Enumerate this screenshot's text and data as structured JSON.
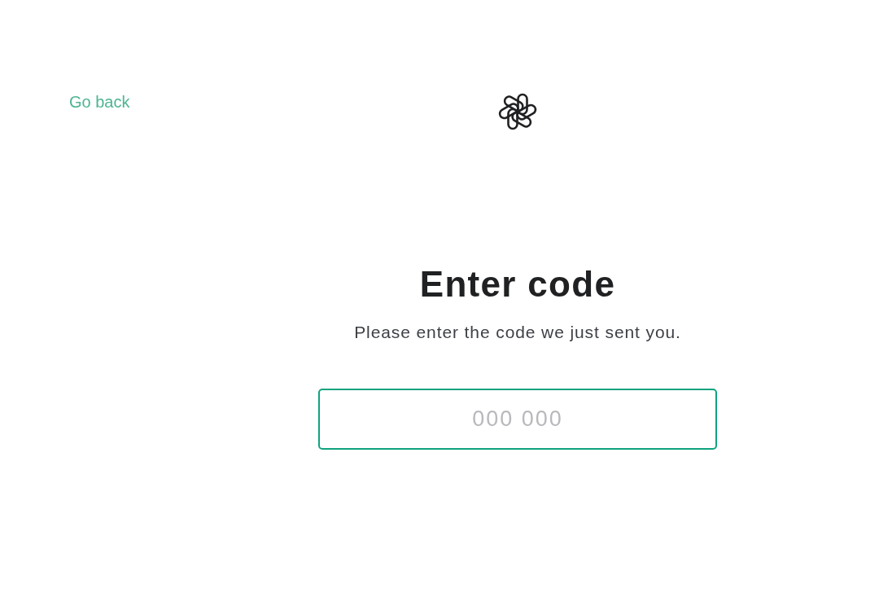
{
  "back_link": {
    "label": "Go back"
  },
  "heading": "Enter code",
  "subtitle": "Please enter the code we just sent you.",
  "code_field": {
    "placeholder": "000 000"
  }
}
